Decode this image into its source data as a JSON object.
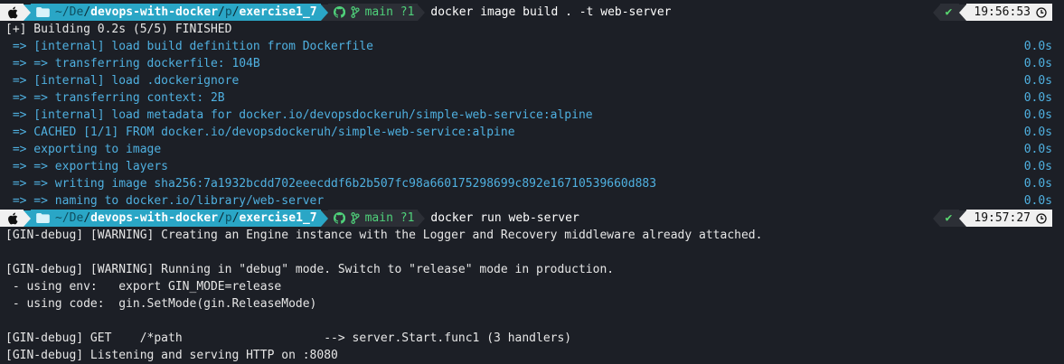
{
  "colors": {
    "background": "#1c1f26",
    "build_text": "#4fb0e0",
    "dir_segment": "#2aa6c6",
    "git_text": "#4fd17a",
    "status_ok": "#58d66f"
  },
  "icons": {
    "os": "apple-icon",
    "dir": "folder-icon",
    "repo": "github-icon",
    "branch": "git-branch-icon",
    "status": "checkmark-icon",
    "time": "clock-icon"
  },
  "prompts": [
    {
      "dir_tilde": "~/",
      "dir_part1": "De",
      "dir_sep1": "/",
      "dir_part2": "devops-with-docker",
      "dir_sep2": "/",
      "dir_part3": "p",
      "dir_sep3": "/",
      "dir_part4": "exercise1_7",
      "git_branch": "main ?1",
      "command": "docker image build . -t web-server",
      "status": "✔",
      "time": "19:56:53"
    },
    {
      "dir_tilde": "~/",
      "dir_part1": "De",
      "dir_sep1": "/",
      "dir_part2": "devops-with-docker",
      "dir_sep2": "/",
      "dir_part3": "p",
      "dir_sep3": "/",
      "dir_part4": "exercise1_7",
      "git_branch": "main ?1",
      "command": "docker run web-server",
      "status": "✔",
      "time": "19:57:27"
    }
  ],
  "build_output": {
    "header": "[+] Building 0.2s (5/5) FINISHED",
    "steps": [
      {
        "text": " => [internal] load build definition from Dockerfile",
        "duration": "0.0s"
      },
      {
        "text": " => => transferring dockerfile: 104B",
        "duration": "0.0s"
      },
      {
        "text": " => [internal] load .dockerignore",
        "duration": "0.0s"
      },
      {
        "text": " => => transferring context: 2B",
        "duration": "0.0s"
      },
      {
        "text": " => [internal] load metadata for docker.io/devopsdockeruh/simple-web-service:alpine",
        "duration": "0.0s"
      },
      {
        "text": " => CACHED [1/1] FROM docker.io/devopsdockeruh/simple-web-service:alpine",
        "duration": "0.0s"
      },
      {
        "text": " => exporting to image",
        "duration": "0.0s"
      },
      {
        "text": " => => exporting layers",
        "duration": "0.0s"
      },
      {
        "text": " => => writing image sha256:7a1932bcdd702eeecddf6b2b507fc98a660175298699c892e16710539660d883",
        "duration": "0.0s"
      },
      {
        "text": " => => naming to docker.io/library/web-server",
        "duration": "0.0s"
      }
    ]
  },
  "run_output": [
    "[GIN-debug] [WARNING] Creating an Engine instance with the Logger and Recovery middleware already attached.",
    "",
    "[GIN-debug] [WARNING] Running in \"debug\" mode. Switch to \"release\" mode in production.",
    " - using env:   export GIN_MODE=release",
    " - using code:  gin.SetMode(gin.ReleaseMode)",
    "",
    "[GIN-debug] GET    /*path                    --> server.Start.func1 (3 handlers)",
    "[GIN-debug] Listening and serving HTTP on :8080"
  ]
}
